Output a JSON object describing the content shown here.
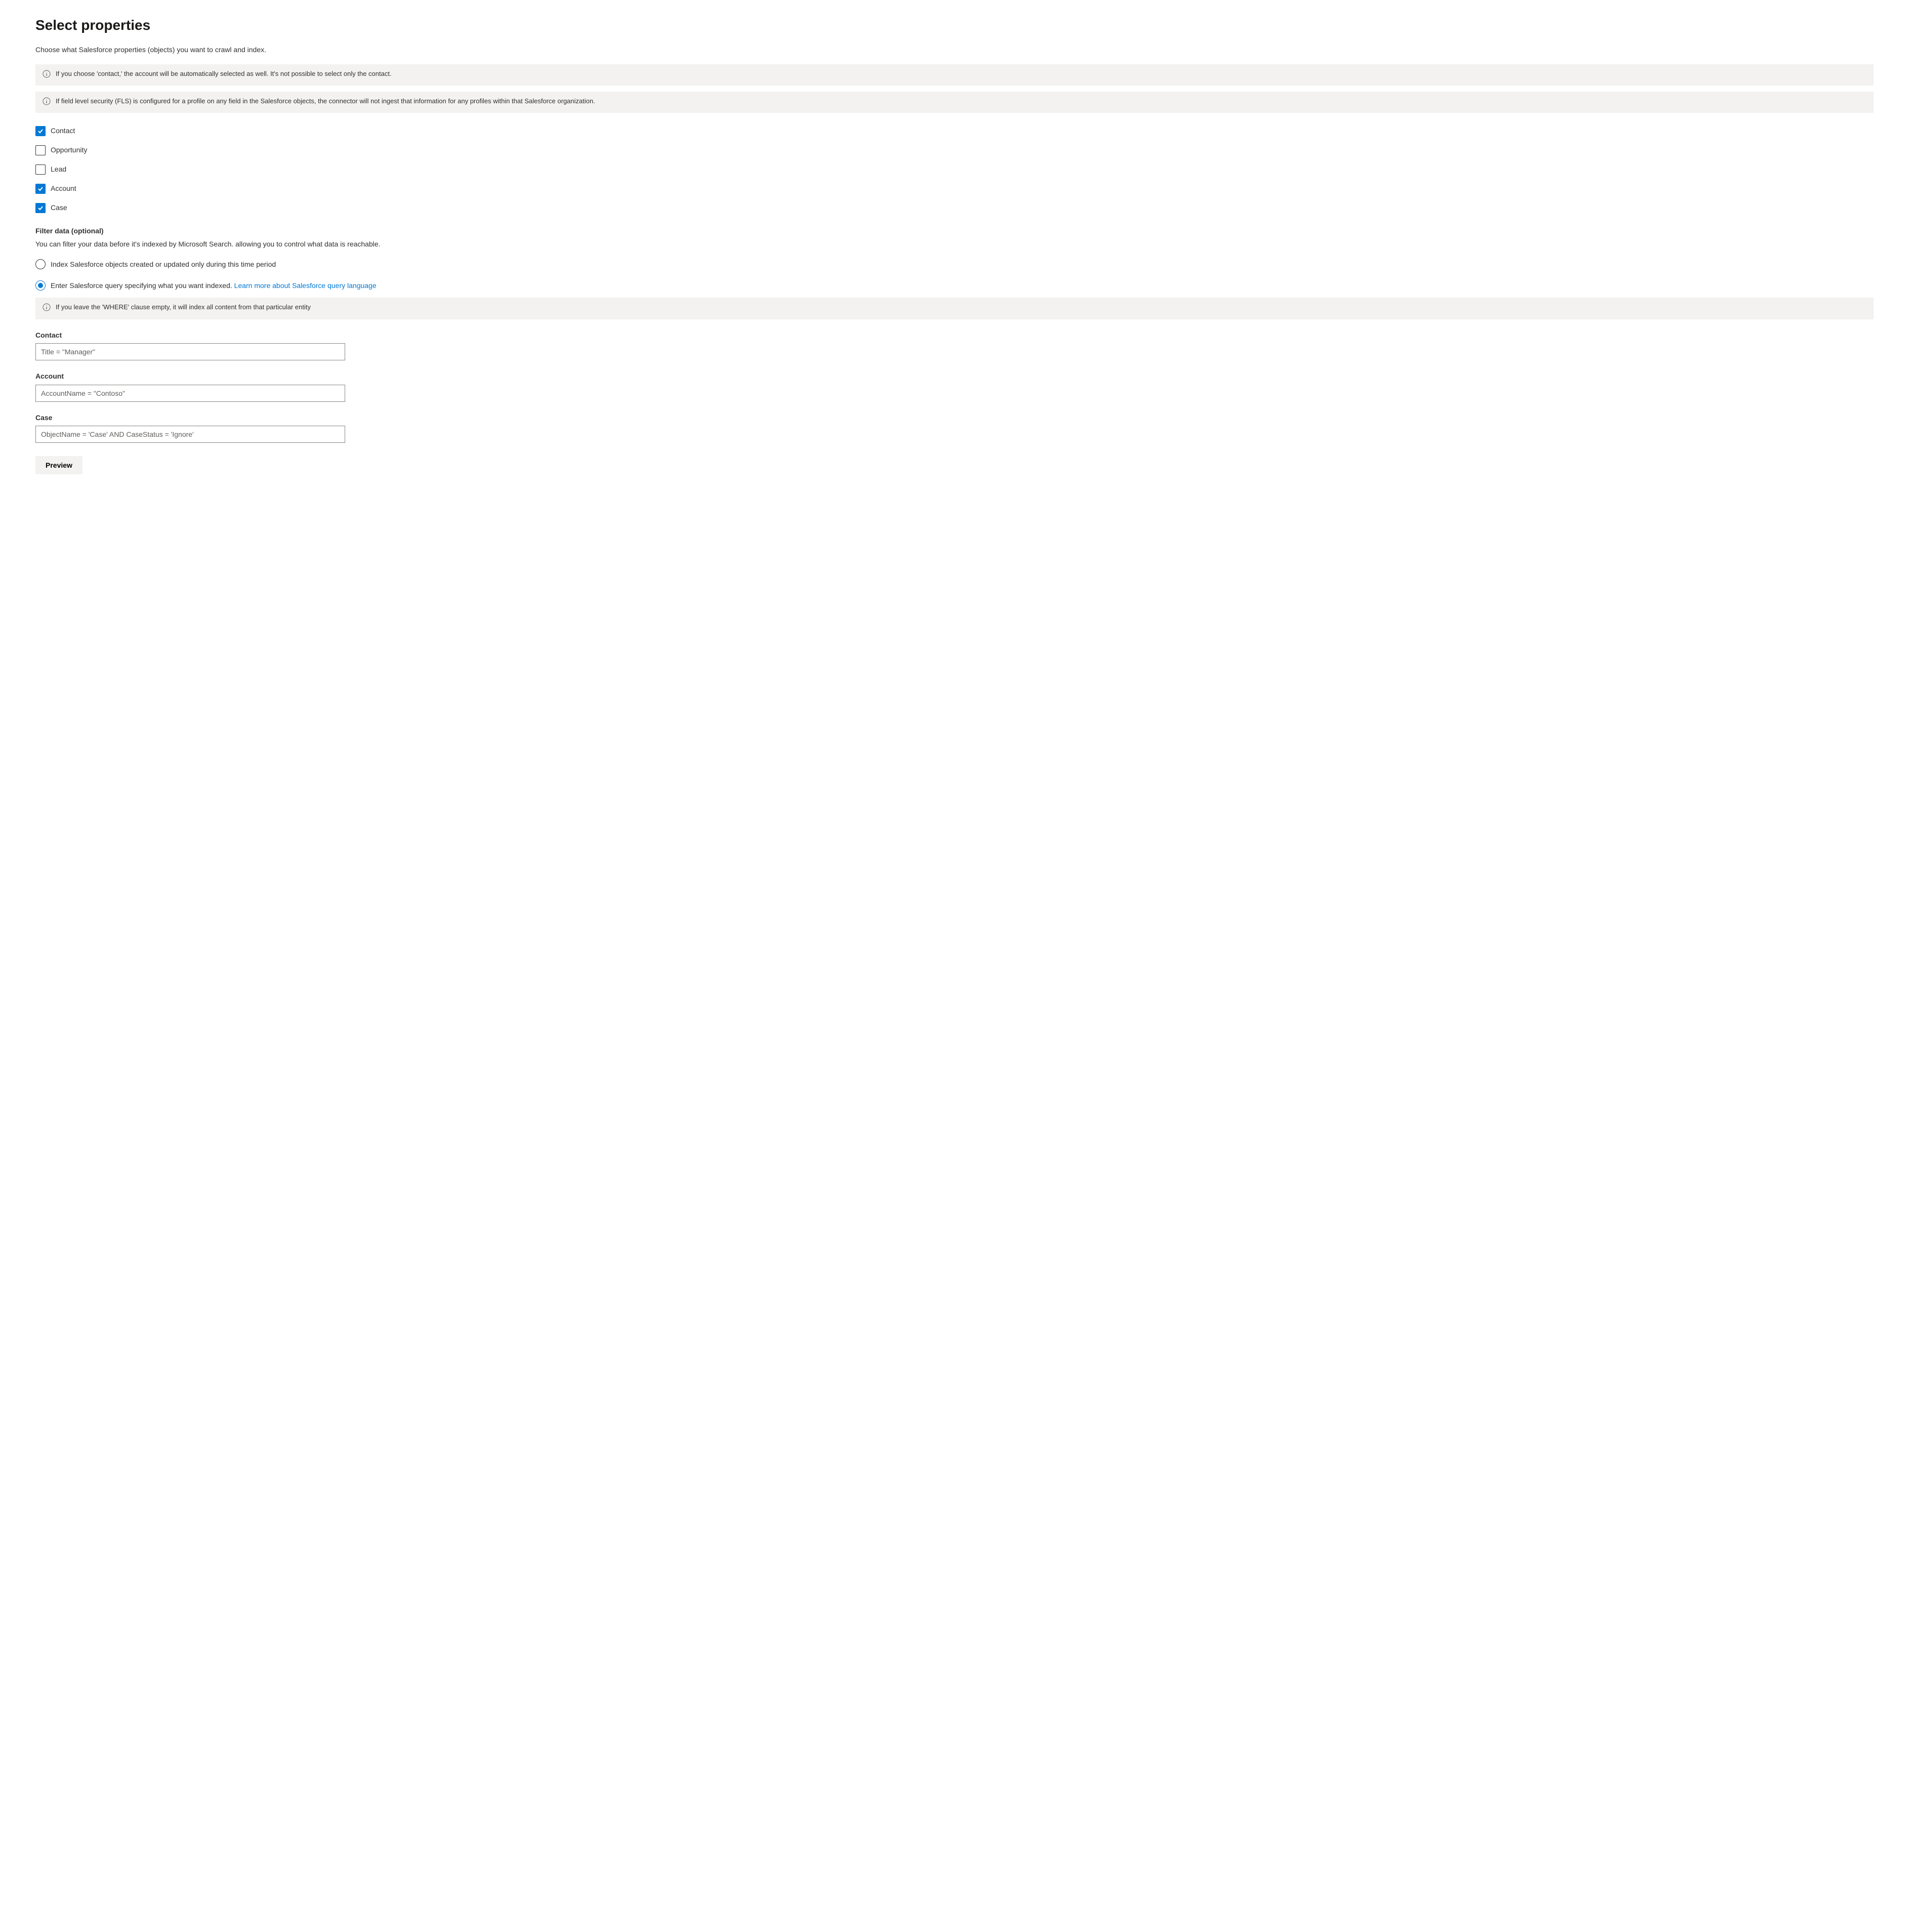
{
  "header": {
    "title": "Select properties",
    "subtitle": "Choose what Salesforce properties (objects) you want to crawl and index."
  },
  "infoboxes": {
    "contact_auto": "If you choose 'contact,' the account will be automatically selected as well. It's not possible to select only the contact.",
    "fls": "If field level security (FLS) is configured for a profile on any field in the Salesforce objects, the connector will not ingest that information for any profiles within that Salesforce organization.",
    "where_empty": "If you leave the 'WHERE' clause empty, it will index all content from that particular entity"
  },
  "properties": [
    {
      "label": "Contact",
      "checked": true
    },
    {
      "label": "Opportunity",
      "checked": false
    },
    {
      "label": "Lead",
      "checked": false
    },
    {
      "label": "Account",
      "checked": true
    },
    {
      "label": "Case",
      "checked": true
    }
  ],
  "filter": {
    "title": "Filter data (optional)",
    "desc": "You can filter your data before it's indexed by Microsoft Search. allowing you to control what data is reachable.",
    "radio_time": "Index Salesforce objects created or updated only during this time period",
    "radio_query": "Enter Salesforce query specifying what you want indexed.",
    "learn_more": "Learn more about Salesforce query language",
    "selected": "query"
  },
  "queries": {
    "contact": {
      "label": "Contact",
      "placeholder": "Title = \"Manager\""
    },
    "account": {
      "label": "Account",
      "placeholder": "AccountName = \"Contoso\""
    },
    "case": {
      "label": "Case",
      "placeholder": "ObjectName = 'Case' AND CaseStatus = 'Ignore'"
    }
  },
  "buttons": {
    "preview": "Preview"
  }
}
